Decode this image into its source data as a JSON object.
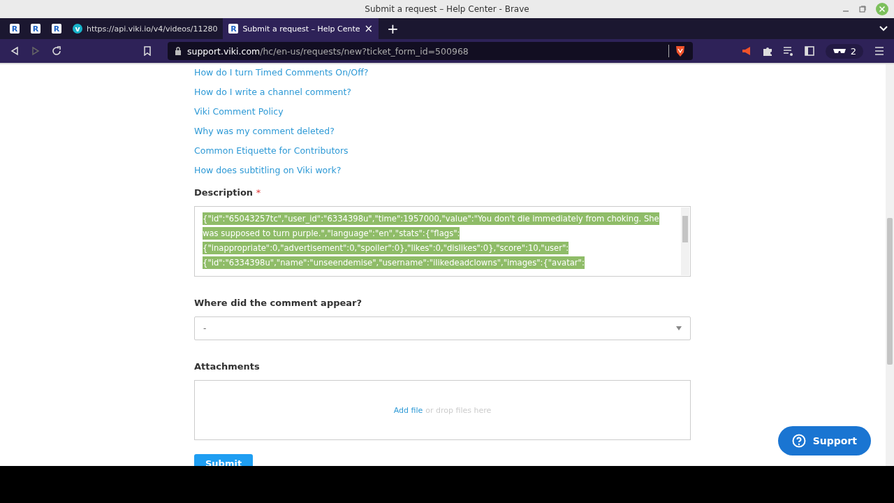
{
  "window": {
    "title": "Submit a request – Help Center - Brave"
  },
  "tabs": [
    {
      "kind": "pinned",
      "icon": "R",
      "selected": false
    },
    {
      "kind": "pinned",
      "icon": "R",
      "selected": false
    },
    {
      "kind": "pinned",
      "icon": "R",
      "selected": false
    },
    {
      "kind": "normal",
      "icon": "v",
      "label": "https://api.viki.io/v4/videos/11280",
      "selected": false
    },
    {
      "kind": "normal",
      "icon": "R",
      "label": "Submit a request – Help Cente",
      "selected": true,
      "close": "×"
    }
  ],
  "new_tab": "+",
  "address": {
    "host": "support.viki.com",
    "path": "/hc/en-us/requests/new?ticket_form_id=500968"
  },
  "profile_count": "2",
  "links": [
    {
      "label": "How do I turn Timed Comments On/Off?"
    },
    {
      "label": "How do I write a channel comment?"
    },
    {
      "label": "Viki Comment Policy"
    },
    {
      "label": "Why was my comment deleted?"
    },
    {
      "label": "Common Etiquette for Contributors"
    },
    {
      "label": "How does subtitling on Viki work?"
    }
  ],
  "description": {
    "label": "Description",
    "required": "*",
    "lines": [
      "{\"id\":\"65043257tc\",\"user_id\":\"6334398u\",\"time\":1957000,\"value\":\"You don't die immediately from choking. She",
      "was supposed to turn purple.\",\"language\":\"en\",\"stats\":{\"flags\":",
      "{\"inappropriate\":0,\"advertisement\":0,\"spoiler\":0},\"likes\":0,\"dislikes\":0},\"score\":10,\"user\":",
      "{\"id\":\"6334398u\",\"name\":\"unseendemise\",\"username\":\"ilikedeadclowns\",\"images\":{\"avatar\":"
    ],
    "selected": true
  },
  "appear": {
    "label": "Where did the comment appear?",
    "value": "-"
  },
  "attachments": {
    "label": "Attachments",
    "link": "Add file",
    "hint": "or drop files here"
  },
  "submit": "Submit",
  "support": "Support"
}
